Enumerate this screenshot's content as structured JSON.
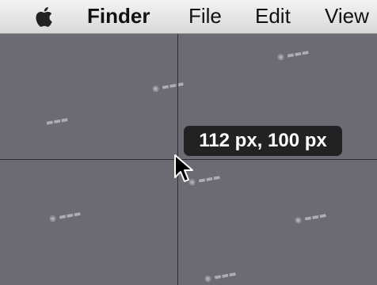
{
  "menubar": {
    "apple_icon": "apple-logo-icon",
    "app_name": "Finder",
    "items": [
      {
        "label": "File"
      },
      {
        "label": "Edit"
      },
      {
        "label": "View"
      }
    ]
  },
  "crosshair": {
    "readout": "112 px, 100 px"
  },
  "cursor": {
    "icon": "arrow-pointer-icon"
  },
  "colors": {
    "desktop": "#6b6b74",
    "menubar": "#e8e8e8",
    "tooltip": "#1c1c1e",
    "crosshair": "#2d2d33"
  }
}
